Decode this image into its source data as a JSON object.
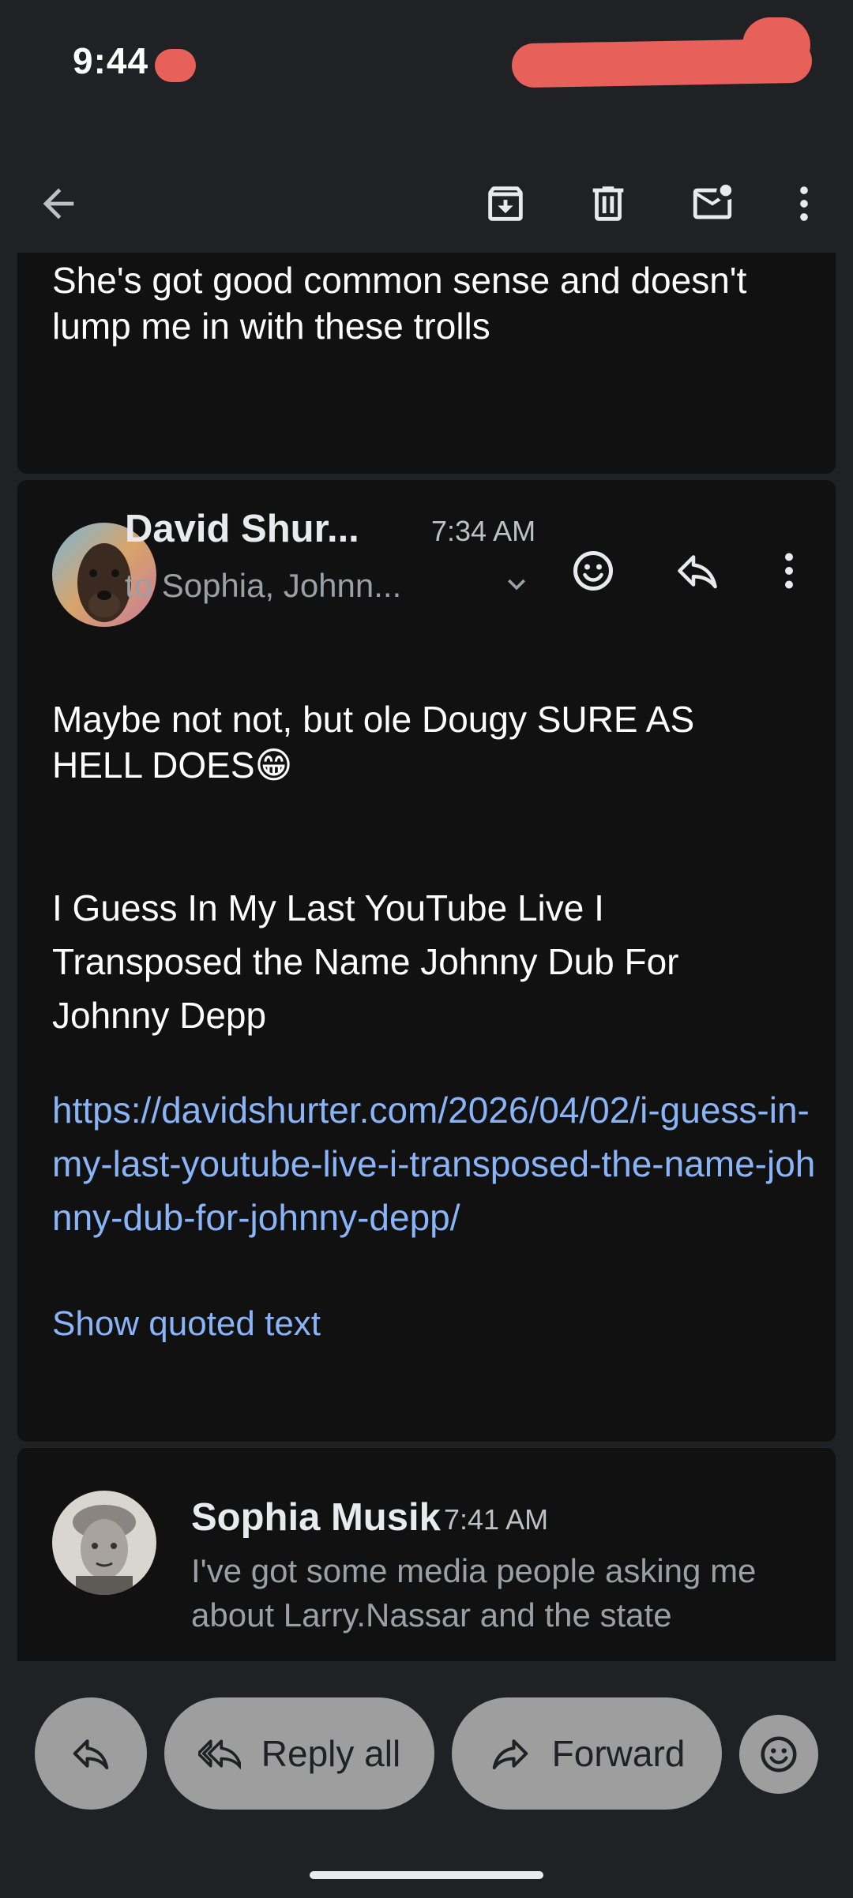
{
  "status": {
    "time": "9:44"
  },
  "toolbar": {
    "back_icon": "arrow-left-icon",
    "archive_icon": "archive-icon",
    "delete_icon": "trash-icon",
    "mark_unread_icon": "mail-unread-icon",
    "more_icon": "more-vert-icon"
  },
  "message1": {
    "body": "She's got good common sense and doesn't lump me in with these trolls"
  },
  "message2": {
    "sender": "David Shur...",
    "time": "7:34 AM",
    "recipients": "to Sophia, Johnn...",
    "paragraph1": "Maybe not not, but ole Dougy SURE AS HELL DOES😁",
    "paragraph2": "I Guess In My Last YouTube Live I Transposed the Name Johnny Dub For Johnny Depp",
    "link": "https://davidshurter.com/2026/04/02/i-guess-in-my-last-youtube-live-i-transposed-the-name-johnny-dub-for-johnny-depp/",
    "show_quoted": "Show quoted text"
  },
  "message3": {
    "sender": "Sophia Musik",
    "time": "7:41 AM",
    "snippet": "I've got some media people asking me about Larry.Nassar and the state"
  },
  "actions": {
    "reply_all": "Reply all",
    "forward": "Forward"
  },
  "colors": {
    "background": "#202124",
    "card": "#111111",
    "link": "#8ab4f8",
    "pill": "#9e9e9e"
  }
}
